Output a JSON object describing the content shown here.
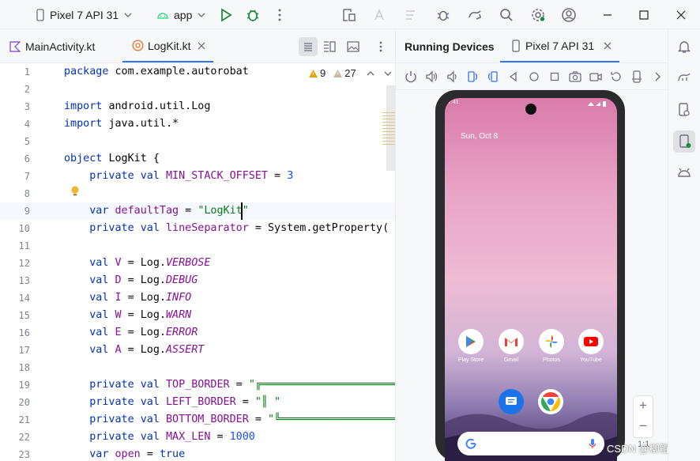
{
  "titlebar": {
    "device": "Pixel 7 API 31",
    "config": "app"
  },
  "editor_tabs": [
    {
      "label": "MainActivity.kt",
      "active": false
    },
    {
      "label": "LogKit.kt",
      "active": true
    }
  ],
  "inspections": {
    "warnings": "9",
    "weak_warnings": "27"
  },
  "running_devices": {
    "title": "Running Devices",
    "device_tab": "Pixel 7 API 31"
  },
  "phone": {
    "time": "7:41",
    "date": "Sun, Oct 8",
    "apps": [
      "Play Store",
      "Gmail",
      "Photos",
      "YouTube"
    ]
  },
  "zoom": {
    "plus": "+",
    "minus": "−",
    "ratio": "1:1"
  },
  "watermark": "CSDN @柳鲲鹏",
  "code": {
    "line_numbers": [
      "1",
      "2",
      "3",
      "4",
      "5",
      "6",
      "7",
      "8",
      "9",
      "10",
      "11",
      "12",
      "13",
      "14",
      "15",
      "16",
      "17",
      "18",
      "19",
      "20",
      "21",
      "22",
      "23"
    ],
    "lines": [
      {
        "n": 1,
        "segs": [
          [
            "kw",
            "package "
          ],
          [
            "",
            "com.example.autorobat"
          ]
        ]
      },
      {
        "n": 2,
        "segs": []
      },
      {
        "n": 3,
        "segs": [
          [
            "kw",
            "import "
          ],
          [
            "",
            "android.util.Log"
          ]
        ]
      },
      {
        "n": 4,
        "segs": [
          [
            "kw",
            "import "
          ],
          [
            "",
            "java.util.*"
          ]
        ]
      },
      {
        "n": 5,
        "segs": []
      },
      {
        "n": 6,
        "segs": [
          [
            "kw",
            "object "
          ],
          [
            "obj",
            "LogKit {"
          ]
        ]
      },
      {
        "n": 7,
        "segs": [
          [
            "",
            "    "
          ],
          [
            "kw",
            "private val "
          ],
          [
            "prop",
            "MIN_STACK_OFFSET"
          ],
          [
            "",
            " = "
          ],
          [
            "num",
            "3"
          ]
        ]
      },
      {
        "n": 8,
        "segs": []
      },
      {
        "n": 9,
        "segs": [
          [
            "",
            "    "
          ],
          [
            "kw",
            "var "
          ],
          [
            "prop",
            "defaultTag"
          ],
          [
            "",
            " = "
          ],
          [
            "str",
            "\"LogKit\""
          ]
        ]
      },
      {
        "n": 10,
        "segs": [
          [
            "",
            "    "
          ],
          [
            "kw",
            "private val "
          ],
          [
            "prop",
            "lineSeparator"
          ],
          [
            "",
            " = System.getProperty( k"
          ]
        ]
      },
      {
        "n": 11,
        "segs": []
      },
      {
        "n": 12,
        "segs": [
          [
            "",
            "    "
          ],
          [
            "kw",
            "val "
          ],
          [
            "prop",
            "V"
          ],
          [
            "",
            " = Log."
          ],
          [
            "it",
            "VERBOSE"
          ]
        ]
      },
      {
        "n": 13,
        "segs": [
          [
            "",
            "    "
          ],
          [
            "kw",
            "val "
          ],
          [
            "prop",
            "D"
          ],
          [
            "",
            " = Log."
          ],
          [
            "it",
            "DEBUG"
          ]
        ]
      },
      {
        "n": 14,
        "segs": [
          [
            "",
            "    "
          ],
          [
            "kw",
            "val "
          ],
          [
            "prop",
            "I"
          ],
          [
            "",
            " = Log."
          ],
          [
            "it",
            "INFO"
          ]
        ]
      },
      {
        "n": 15,
        "segs": [
          [
            "",
            "    "
          ],
          [
            "kw",
            "val "
          ],
          [
            "prop",
            "W"
          ],
          [
            "",
            " = Log."
          ],
          [
            "it",
            "WARN"
          ]
        ]
      },
      {
        "n": 16,
        "segs": [
          [
            "",
            "    "
          ],
          [
            "kw",
            "val "
          ],
          [
            "prop",
            "E"
          ],
          [
            "",
            " = Log."
          ],
          [
            "it",
            "ERROR"
          ]
        ]
      },
      {
        "n": 17,
        "segs": [
          [
            "",
            "    "
          ],
          [
            "kw",
            "val "
          ],
          [
            "prop",
            "A"
          ],
          [
            "",
            " = Log."
          ],
          [
            "it",
            "ASSERT"
          ]
        ]
      },
      {
        "n": 18,
        "segs": []
      },
      {
        "n": 19,
        "segs": [
          [
            "",
            "    "
          ],
          [
            "kw",
            "private val "
          ],
          [
            "prop",
            "TOP_BORDER"
          ],
          [
            "",
            " = "
          ],
          [
            "str",
            "\"╔══════════════════════"
          ]
        ]
      },
      {
        "n": 20,
        "segs": [
          [
            "",
            "    "
          ],
          [
            "kw",
            "private val "
          ],
          [
            "prop",
            "LEFT_BORDER"
          ],
          [
            "",
            " = "
          ],
          [
            "str",
            "\"║ \""
          ]
        ]
      },
      {
        "n": 21,
        "segs": [
          [
            "",
            "    "
          ],
          [
            "kw",
            "private val "
          ],
          [
            "prop",
            "BOTTOM_BORDER"
          ],
          [
            "",
            " = "
          ],
          [
            "str",
            "\"╚════════════════════"
          ]
        ]
      },
      {
        "n": 22,
        "segs": [
          [
            "",
            "    "
          ],
          [
            "kw",
            "private val "
          ],
          [
            "prop",
            "MAX_LEN"
          ],
          [
            "",
            " = "
          ],
          [
            "num",
            "1000"
          ]
        ]
      },
      {
        "n": 23,
        "segs": [
          [
            "",
            "    "
          ],
          [
            "kw",
            "var "
          ],
          [
            "prop",
            "open"
          ],
          [
            "",
            " = "
          ],
          [
            "kw",
            "true"
          ]
        ]
      }
    ]
  },
  "colors": {
    "accent": "#3574f0",
    "keyword": "#0033b3",
    "property": "#871094",
    "string": "#067d17",
    "number": "#1750eb",
    "warning": "#e2a300"
  }
}
